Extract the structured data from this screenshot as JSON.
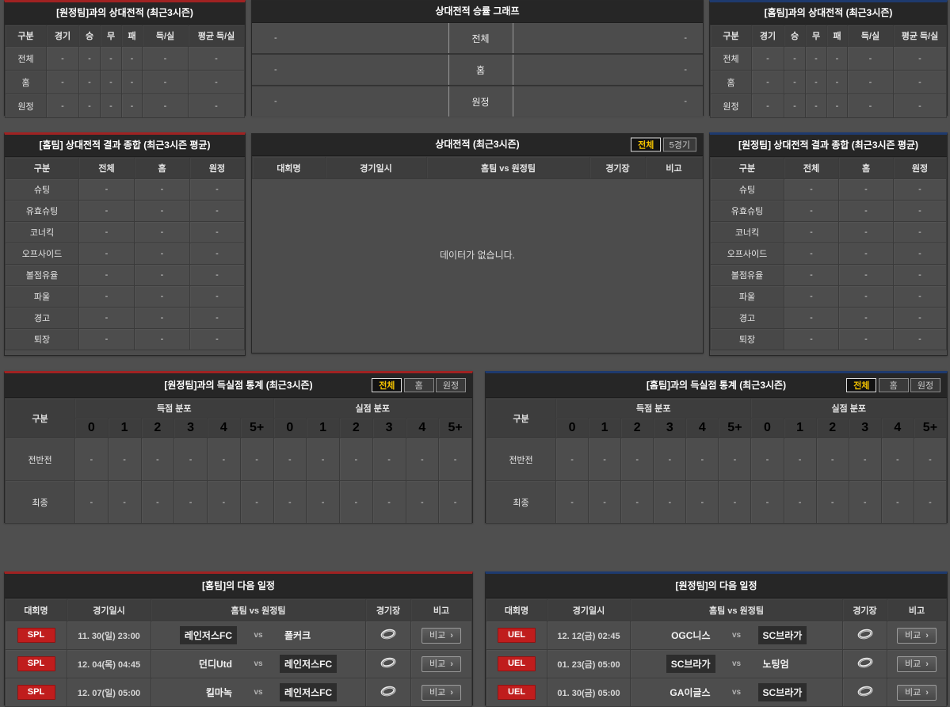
{
  "colors": {
    "page_background": "#4f4f4f",
    "panel_background": "#4c4c4c",
    "title_bar": "#262626",
    "accent_home_red": "#a02222",
    "accent_away_blue": "#1e3a6e",
    "league_badge_red": "#c01d1d",
    "active_tab_yellow": "#f3c200"
  },
  "h2h_away": {
    "title": "[원정팀]과의 상대전적 (최근3시즌)",
    "columns": [
      "구분",
      "경기",
      "승",
      "무",
      "패",
      "득/실",
      "평균 득/실"
    ],
    "rows": [
      {
        "label": "전체",
        "values": [
          "-",
          "-",
          "-",
          "-",
          "-",
          "-"
        ]
      },
      {
        "label": "홈",
        "values": [
          "-",
          "-",
          "-",
          "-",
          "-",
          "-"
        ]
      },
      {
        "label": "원정",
        "values": [
          "-",
          "-",
          "-",
          "-",
          "-",
          "-"
        ]
      }
    ]
  },
  "winrate_graph": {
    "title": "상대전적 승률 그래프",
    "rows": [
      {
        "label": "전체",
        "left": "-",
        "right": "-"
      },
      {
        "label": "홈",
        "left": "-",
        "right": "-"
      },
      {
        "label": "원정",
        "left": "-",
        "right": "-"
      }
    ]
  },
  "h2h_home": {
    "title": "[홈팀]과의 상대전적 (최근3시즌)",
    "columns": [
      "구분",
      "경기",
      "승",
      "무",
      "패",
      "득/실",
      "평균 득/실"
    ],
    "rows": [
      {
        "label": "전체",
        "values": [
          "-",
          "-",
          "-",
          "-",
          "-",
          "-"
        ]
      },
      {
        "label": "홈",
        "values": [
          "-",
          "-",
          "-",
          "-",
          "-",
          "-"
        ]
      },
      {
        "label": "원정",
        "values": [
          "-",
          "-",
          "-",
          "-",
          "-",
          "-"
        ]
      }
    ]
  },
  "summary_home": {
    "title": "[홈팀] 상대전적 결과 종합 (최근3시즌 평균)",
    "columns": [
      "구분",
      "전체",
      "홈",
      "원정"
    ],
    "rows": [
      {
        "label": "슈팅",
        "values": [
          "-",
          "-",
          "-"
        ]
      },
      {
        "label": "유효슈팅",
        "values": [
          "-",
          "-",
          "-"
        ]
      },
      {
        "label": "코너킥",
        "values": [
          "-",
          "-",
          "-"
        ]
      },
      {
        "label": "오프사이드",
        "values": [
          "-",
          "-",
          "-"
        ]
      },
      {
        "label": "볼점유율",
        "values": [
          "-",
          "-",
          "-"
        ]
      },
      {
        "label": "파울",
        "values": [
          "-",
          "-",
          "-"
        ]
      },
      {
        "label": "경고",
        "values": [
          "-",
          "-",
          "-"
        ]
      },
      {
        "label": "퇴장",
        "values": [
          "-",
          "-",
          "-"
        ]
      }
    ]
  },
  "h2h_list": {
    "title": "상대전적 (최근3시즌)",
    "tabs": [
      "전체",
      "5경기"
    ],
    "active_tab": "전체",
    "columns": [
      "대회명",
      "경기일시",
      "홈팀  vs  원정팀",
      "경기장",
      "비고"
    ],
    "empty_message": "데이터가 없습니다."
  },
  "summary_away": {
    "title": "[원정팀] 상대전적 결과 종합 (최근3시즌 평균)",
    "columns": [
      "구분",
      "전체",
      "홈",
      "원정"
    ],
    "rows": [
      {
        "label": "슈팅",
        "values": [
          "-",
          "-",
          "-"
        ]
      },
      {
        "label": "유효슈팅",
        "values": [
          "-",
          "-",
          "-"
        ]
      },
      {
        "label": "코너킥",
        "values": [
          "-",
          "-",
          "-"
        ]
      },
      {
        "label": "오프사이드",
        "values": [
          "-",
          "-",
          "-"
        ]
      },
      {
        "label": "볼점유율",
        "values": [
          "-",
          "-",
          "-"
        ]
      },
      {
        "label": "파울",
        "values": [
          "-",
          "-",
          "-"
        ]
      },
      {
        "label": "경고",
        "values": [
          "-",
          "-",
          "-"
        ]
      },
      {
        "label": "퇴장",
        "values": [
          "-",
          "-",
          "-"
        ]
      }
    ]
  },
  "goals_away": {
    "title": "[원정팀]과의 득실점 통계 (최근3시즌)",
    "tabs": [
      "전체",
      "홈",
      "원정"
    ],
    "active_tab": "전체",
    "gubun": "구분",
    "group1": "득점 분포",
    "group2": "실점 분포",
    "bin_labels": [
      "0",
      "1",
      "2",
      "3",
      "4",
      "5+",
      "0",
      "1",
      "2",
      "3",
      "4",
      "5+"
    ],
    "rows": [
      {
        "label": "전반전",
        "values": [
          "-",
          "-",
          "-",
          "-",
          "-",
          "-",
          "-",
          "-",
          "-",
          "-",
          "-",
          "-"
        ]
      },
      {
        "label": "최종",
        "values": [
          "-",
          "-",
          "-",
          "-",
          "-",
          "-",
          "-",
          "-",
          "-",
          "-",
          "-",
          "-"
        ]
      }
    ]
  },
  "goals_home": {
    "title": "[홈팀]과의 득실점 통계 (최근3시즌)",
    "tabs": [
      "전체",
      "홈",
      "원정"
    ],
    "active_tab": "전체",
    "gubun": "구분",
    "group1": "득점 분포",
    "group2": "실점 분포",
    "bin_labels": [
      "0",
      "1",
      "2",
      "3",
      "4",
      "5+",
      "0",
      "1",
      "2",
      "3",
      "4",
      "5+"
    ],
    "rows": [
      {
        "label": "전반전",
        "values": [
          "-",
          "-",
          "-",
          "-",
          "-",
          "-",
          "-",
          "-",
          "-",
          "-",
          "-",
          "-"
        ]
      },
      {
        "label": "최종",
        "values": [
          "-",
          "-",
          "-",
          "-",
          "-",
          "-",
          "-",
          "-",
          "-",
          "-",
          "-",
          "-"
        ]
      }
    ]
  },
  "schedule_home": {
    "title": "[홈팀]의 다음 일정",
    "columns": [
      "대회명",
      "경기일시",
      "홈팀  vs  원정팀",
      "경기장",
      "비고"
    ],
    "vs_label": "vs",
    "compare_label": "비교",
    "compare_arrow": "›",
    "stadium_icon": "stadium-icon",
    "rows": [
      {
        "league": "SPL",
        "datetime": "11. 30(일) 23:00",
        "home": "레인저스FC",
        "away": "폴커크",
        "home_hl": true,
        "away_hl": false
      },
      {
        "league": "SPL",
        "datetime": "12. 04(목) 04:45",
        "home": "던디Utd",
        "away": "레인저스FC",
        "home_hl": false,
        "away_hl": true
      },
      {
        "league": "SPL",
        "datetime": "12. 07(일) 05:00",
        "home": "킬마녹",
        "away": "레인저스FC",
        "home_hl": false,
        "away_hl": true
      }
    ]
  },
  "schedule_away": {
    "title": "[원정팀]의 다음 일정",
    "columns": [
      "대회명",
      "경기일시",
      "홈팀  vs  원정팀",
      "경기장",
      "비고"
    ],
    "vs_label": "vs",
    "compare_label": "비교",
    "compare_arrow": "›",
    "stadium_icon": "stadium-icon",
    "rows": [
      {
        "league": "UEL",
        "datetime": "12. 12(금) 02:45",
        "home": "OGC니스",
        "away": "SC브라가",
        "home_hl": false,
        "away_hl": true
      },
      {
        "league": "UEL",
        "datetime": "01. 23(금) 05:00",
        "home": "SC브라가",
        "away": "노팅엄",
        "home_hl": true,
        "away_hl": false
      },
      {
        "league": "UEL",
        "datetime": "01. 30(금) 05:00",
        "home": "GA이글스",
        "away": "SC브라가",
        "home_hl": false,
        "away_hl": true
      }
    ]
  }
}
